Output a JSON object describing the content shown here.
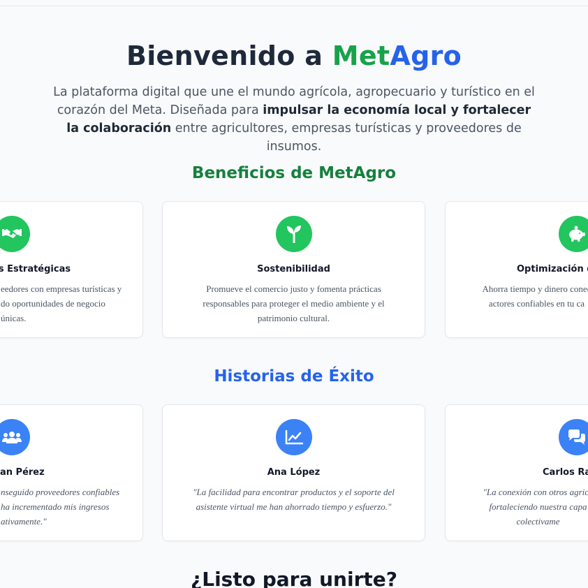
{
  "hero": {
    "title_prefix": "Bienvenido a ",
    "brand_part1": "Met",
    "brand_part2": "Agro",
    "text_part1": "La plataforma digital que une el mundo agrícola, agropecuario y turístico en el corazón del Meta. Diseñada para ",
    "text_bold": "impulsar la economía local y fortalecer la colaboración",
    "text_part2": " entre agricultores, empresas turísticas y proveedores de insumos."
  },
  "benefits": {
    "title": "Beneficios de MetAgro",
    "items": [
      {
        "icon": "handshake-icon",
        "title": "es Estratégicas",
        "text": "eedores con empresas turísticas y do oportunidades de negocio únicas."
      },
      {
        "icon": "seedling-icon",
        "title": "Sostenibilidad",
        "text": "Promueve el comercio justo y fomenta prácticas responsables para proteger el medio ambiente y el patrimonio cultural."
      },
      {
        "icon": "piggy-bank-icon",
        "title": "Optimización d",
        "text": "Ahorra tiempo y dinero conec actores confiables en tu ca"
      }
    ]
  },
  "stories": {
    "title": "Historias de Éxito",
    "items": [
      {
        "icon": "users-icon",
        "name": "an Pérez",
        "quote": "nseguido proveedores confiables ha incrementado mis ingresos ativamente.\""
      },
      {
        "icon": "chart-line-icon",
        "name": "Ana López",
        "quote": "\"La facilidad para encontrar productos y el soporte del asistente virtual me han ahorrado tiempo y esfuerzo.\""
      },
      {
        "icon": "comments-icon",
        "name": "Carlos Ra",
        "quote": "\"La conexión con otros agricu fortaleciendo nuestra capa colectivame"
      }
    ]
  },
  "cta": {
    "title": "¿Listo para unirte?"
  },
  "colors": {
    "green": "#22c55e",
    "blue": "#3b82f6",
    "brand_green": "#16a34a",
    "brand_blue": "#2563eb"
  }
}
